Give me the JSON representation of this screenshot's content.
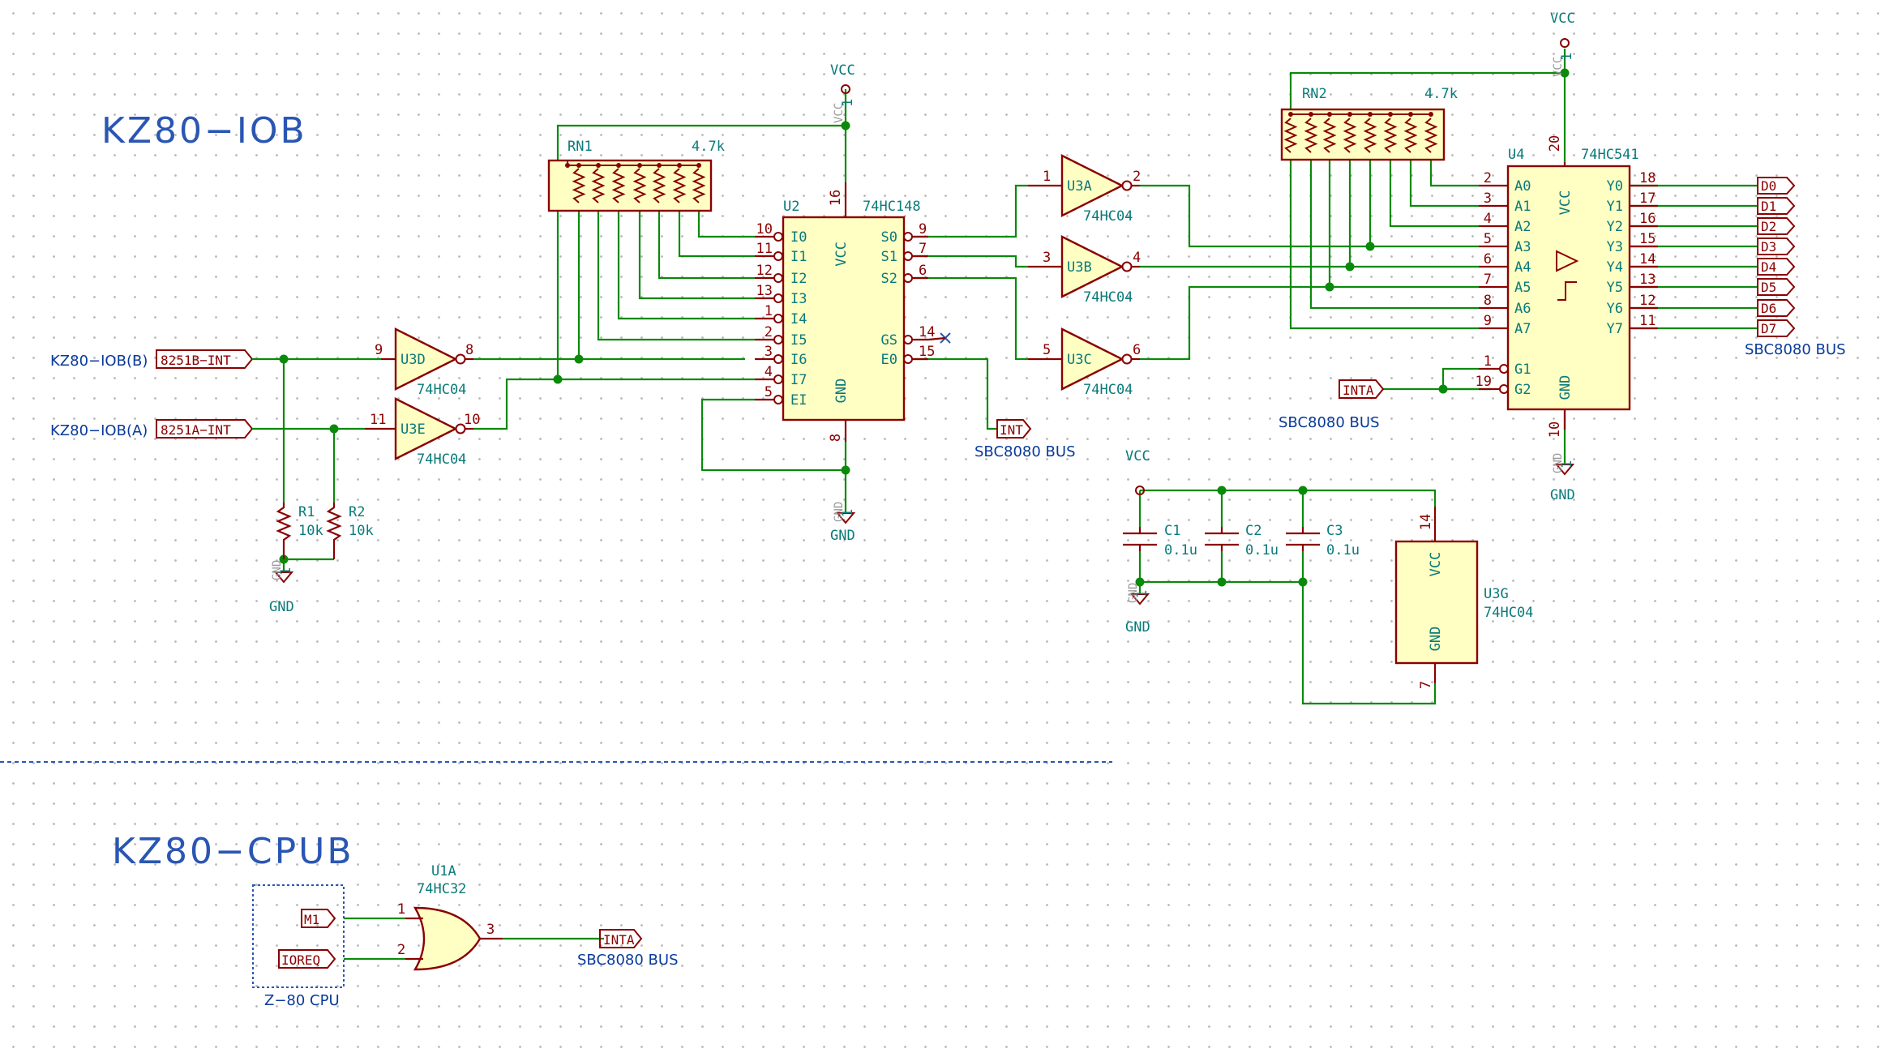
{
  "titles": {
    "iob": "KZ80−IOB",
    "cpub": "KZ80−CPUB"
  },
  "power": {
    "vcc": "VCC",
    "gnd": "GND"
  },
  "nets": {
    "iob_b": "KZ80−IOB(B)",
    "iob_a": "KZ80−IOB(A)",
    "int_b": "8251B−INT",
    "int_a": "8251A−INT",
    "int": "INT",
    "inta": "INTA",
    "m1": "M1",
    "ioreq": "IOREQ",
    "bus": "SBC8080 BUS",
    "z80": "Z−80 CPU",
    "d": [
      "D0",
      "D1",
      "D2",
      "D3",
      "D4",
      "D5",
      "D6",
      "D7"
    ]
  },
  "parts": {
    "rn1": {
      "ref": "RN1",
      "value": "4.7k"
    },
    "rn2": {
      "ref": "RN2",
      "value": "4.7k"
    },
    "u2": {
      "ref": "U2",
      "value": "74HC148"
    },
    "u4": {
      "ref": "U4",
      "value": "74HC541"
    },
    "u3a": "U3A",
    "u3b": "U3B",
    "u3c": "U3C",
    "u3d": "U3D",
    "u3e": "U3E",
    "u3g": "U3G",
    "hc04": "74HC04",
    "r1": {
      "ref": "R1",
      "value": "10k"
    },
    "r2": {
      "ref": "R2",
      "value": "10k"
    },
    "c1": {
      "ref": "C1",
      "value": "0.1u"
    },
    "c2": {
      "ref": "C2",
      "value": "0.1u"
    },
    "c3": {
      "ref": "C3",
      "value": "0.1u"
    },
    "u1a": {
      "ref": "U1A",
      "value": "74HC32"
    }
  },
  "u2_pins": {
    "left_names": [
      "I0",
      "I1",
      "I2",
      "I3",
      "I4",
      "I5",
      "I6",
      "I7",
      "EI"
    ],
    "left_nums": [
      "10",
      "11",
      "12",
      "13",
      "1",
      "2",
      "3",
      "4",
      "5"
    ],
    "right_names": [
      "S0",
      "S1",
      "S2",
      "GS",
      "E0"
    ],
    "right_nums": [
      "9",
      "7",
      "6",
      "14",
      "15"
    ],
    "vcc_num": "16",
    "gnd_num": "8",
    "vcc": "VCC",
    "gnd": "GND"
  },
  "u4_pins": {
    "a_names": [
      "A0",
      "A1",
      "A2",
      "A3",
      "A4",
      "A5",
      "A6",
      "A7"
    ],
    "a_nums": [
      "2",
      "3",
      "4",
      "5",
      "6",
      "7",
      "8",
      "9"
    ],
    "y_names": [
      "Y0",
      "Y1",
      "Y2",
      "Y3",
      "Y4",
      "Y5",
      "Y6",
      "Y7"
    ],
    "y_nums": [
      "18",
      "17",
      "16",
      "15",
      "14",
      "13",
      "12",
      "11"
    ],
    "g_names": [
      "G1",
      "G2"
    ],
    "g_nums": [
      "1",
      "19"
    ],
    "vcc_num": "20",
    "gnd_num": "10",
    "vcc": "VCC",
    "gnd": "GND"
  },
  "inv_pins": {
    "u3a": [
      "1",
      "2"
    ],
    "u3b": [
      "3",
      "4"
    ],
    "u3c": [
      "5",
      "6"
    ],
    "u3d": [
      "9",
      "8"
    ],
    "u3e": [
      "11",
      "10"
    ],
    "u3g": [
      "14",
      "7"
    ],
    "u3g_vcc": "VCC",
    "u3g_gnd": "GND"
  },
  "or_pins": [
    "1",
    "2",
    "3"
  ],
  "pwr_pin": "1",
  "colors": {
    "wire": "#0a8a0a",
    "body": "#8a0000",
    "fill": "#ffffc4",
    "text": "#0a7a7a",
    "net": "#0a3a99",
    "title": "#2a56b3"
  }
}
